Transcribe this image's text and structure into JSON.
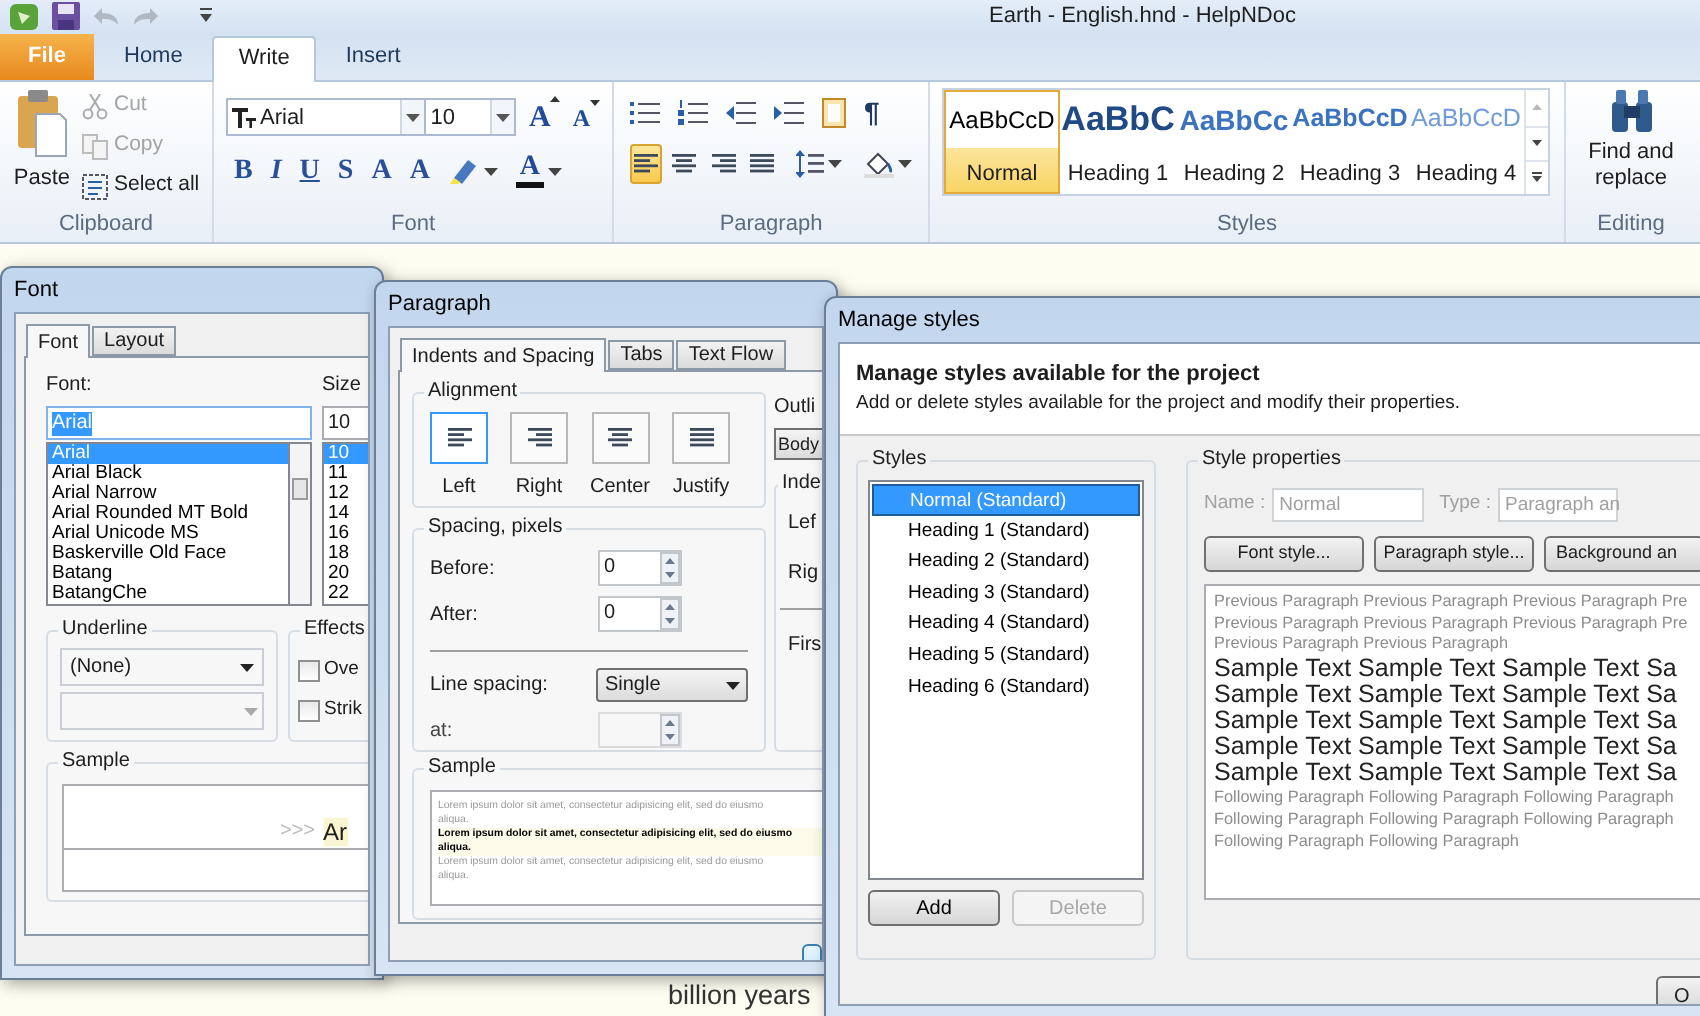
{
  "title_bar": {
    "title": "Earth - English.hnd - HelpNDoc"
  },
  "ribbon_tabs": [
    {
      "label": "File",
      "kind": "application",
      "selected": false
    },
    {
      "label": "Home",
      "kind": "tab",
      "selected": false
    },
    {
      "label": "Write",
      "kind": "tab",
      "selected": true
    },
    {
      "label": "Insert",
      "kind": "tab",
      "selected": false
    }
  ],
  "clipboard": {
    "caption": "Clipboard",
    "paste": "Paste",
    "actions": [
      {
        "label": "Cut",
        "kind": "cut",
        "disabled": true
      },
      {
        "label": "Copy",
        "kind": "copy",
        "disabled": true
      },
      {
        "label": "Select all",
        "kind": "select",
        "disabled": false
      }
    ]
  },
  "font": {
    "caption": "Font",
    "family": "Arial",
    "size": "10",
    "size_buttons": [
      {
        "label": "A",
        "kind": "grow"
      },
      {
        "label": "A",
        "kind": "shrink"
      }
    ],
    "format_buttons": [
      {
        "label": "B",
        "kind": "bold"
      },
      {
        "label": "I",
        "kind": "italic"
      },
      {
        "label": "U",
        "kind": "underline"
      },
      {
        "label": "S",
        "kind": "strike"
      },
      {
        "label": "A",
        "kind": "subscript"
      },
      {
        "label": "A",
        "kind": "superscript"
      }
    ],
    "color_button": "A"
  },
  "paragraph": {
    "caption": "Paragraph",
    "marks_button": "¶",
    "alignments": [
      {
        "kind": "left",
        "selected": true
      },
      {
        "kind": "center",
        "selected": false
      },
      {
        "kind": "right",
        "selected": false
      },
      {
        "kind": "justify",
        "selected": false
      }
    ]
  },
  "styles": {
    "caption": "Styles",
    "items": [
      {
        "sample": "AaBbCcD",
        "label": "Normal",
        "kind": "normal",
        "selected": true
      },
      {
        "sample": "AaBbC",
        "label": "Heading 1",
        "kind": "heading1",
        "selected": false
      },
      {
        "sample": "AaBbCc",
        "label": "Heading 2",
        "kind": "heading2",
        "selected": false
      },
      {
        "sample": "AaBbCcD",
        "label": "Heading 3",
        "kind": "heading3",
        "selected": false
      },
      {
        "sample": "AaBbCcD",
        "label": "Heading 4",
        "kind": "heading4",
        "selected": false
      }
    ]
  },
  "editing": {
    "caption": "Editing",
    "label": "Find and replace"
  },
  "document": {
    "text": "billion years"
  },
  "font_dialog": {
    "title": "Font",
    "tabs": [
      {
        "label": "Font",
        "selected": true
      },
      {
        "label": "Layout",
        "selected": false
      }
    ],
    "font_label": "Font:",
    "font_value": "Arial",
    "fonts": [
      {
        "label": "Arial",
        "selected": true
      },
      {
        "label": "Arial Black",
        "selected": false
      },
      {
        "label": "Arial Narrow",
        "selected": false
      },
      {
        "label": "Arial Rounded MT Bold",
        "selected": false
      },
      {
        "label": "Arial Unicode MS",
        "selected": false
      },
      {
        "label": "Baskerville Old Face",
        "selected": false
      },
      {
        "label": "Batang",
        "selected": false
      },
      {
        "label": "BatangChe",
        "selected": false
      }
    ],
    "size_label": "Size",
    "size_value": "10",
    "sizes": [
      {
        "label": "10",
        "selected": true
      },
      {
        "label": "11",
        "selected": false
      },
      {
        "label": "12",
        "selected": false
      },
      {
        "label": "14",
        "selected": false
      },
      {
        "label": "16",
        "selected": false
      },
      {
        "label": "18",
        "selected": false
      },
      {
        "label": "20",
        "selected": false
      },
      {
        "label": "22",
        "selected": false
      }
    ],
    "underline": {
      "label": "Underline",
      "value": "(None)"
    },
    "effects": {
      "label": "Effects",
      "options": [
        {
          "label": "Ove",
          "checked": false
        },
        {
          "label": "Strik",
          "checked": false
        }
      ]
    },
    "sample": {
      "label": "Sample",
      "marker": ">>>",
      "text": "Ar"
    }
  },
  "paragraph_dialog": {
    "title": "Paragraph",
    "tabs": [
      {
        "label": "Indents and Spacing",
        "selected": true
      },
      {
        "label": "Tabs",
        "selected": false
      },
      {
        "label": "Text Flow",
        "selected": false
      }
    ],
    "alignment": {
      "label": "Alignment",
      "options": [
        {
          "label": "Left",
          "kind": "left",
          "selected": true
        },
        {
          "label": "Right",
          "kind": "right",
          "selected": false
        },
        {
          "label": "Center",
          "kind": "center",
          "selected": false
        },
        {
          "label": "Justify",
          "kind": "justify",
          "selected": false
        }
      ]
    },
    "spacing": {
      "label": "Spacing, pixels",
      "fields": [
        {
          "label": "Before:",
          "value": "0",
          "disabled": false
        },
        {
          "label": "After:",
          "value": "0",
          "disabled": false
        }
      ],
      "line_spacing_label": "Line spacing:",
      "line_spacing": "Single",
      "at": {
        "label": "at:",
        "disabled": true
      }
    },
    "outline": {
      "label": "Outli",
      "value": "Body"
    },
    "indents": {
      "label": "Inde",
      "rows": [
        "Lef",
        "Rig"
      ],
      "first": "Firs"
    },
    "sample": {
      "label": "Sample",
      "paragraphs": [
        {
          "kind": "previous",
          "lines": [
            "Lorem ipsum dolor sit amet, consectetur adipisicing elit, sed do eiusmo",
            "aliqua."
          ]
        },
        {
          "kind": "current",
          "lines": [
            "Lorem ipsum dolor sit amet, consectetur adipisicing elit, sed do eiusmo",
            "aliqua."
          ]
        },
        {
          "kind": "following",
          "lines": [
            "Lorem ipsum dolor sit amet, consectetur adipisicing elit, sed do eiusmo",
            "aliqua."
          ]
        }
      ]
    }
  },
  "manage_styles": {
    "title": "Manage styles",
    "heading": "Manage styles available for the project",
    "description": "Add or delete styles available for the project and modify their properties.",
    "styles_label": "Styles",
    "styles": [
      {
        "label": "Normal (Standard)",
        "selected": true
      },
      {
        "label": "Heading 1 (Standard)",
        "selected": false
      },
      {
        "label": "Heading 2 (Standard)",
        "selected": false
      },
      {
        "label": "Heading 3 (Standard)",
        "selected": false
      },
      {
        "label": "Heading 4 (Standard)",
        "selected": false
      },
      {
        "label": "Heading 5 (Standard)",
        "selected": false
      },
      {
        "label": "Heading 6 (Standard)",
        "selected": false
      }
    ],
    "buttons": [
      {
        "label": "Add",
        "disabled": false
      },
      {
        "label": "Delete",
        "disabled": true
      }
    ],
    "properties": {
      "label": "Style properties",
      "name": {
        "label": "Name :",
        "value": "Normal",
        "disabled": true
      },
      "type": {
        "label": "Type :",
        "value": "Paragraph an",
        "disabled": true
      },
      "buttons": [
        "Font style...",
        "Paragraph style...",
        "Background an"
      ],
      "preview": [
        {
          "kind": "previous",
          "lines": [
            "Previous Paragraph Previous Paragraph Previous Paragraph Pre",
            "Previous Paragraph Previous Paragraph Previous Paragraph Pre",
            "Previous Paragraph Previous Paragraph"
          ]
        },
        {
          "kind": "sample",
          "lines": [
            "Sample Text Sample Text Sample Text Sa",
            "Sample Text Sample Text Sample Text Sa",
            "Sample Text Sample Text Sample Text Sa",
            "Sample Text Sample Text Sample Text Sa",
            "Sample Text Sample Text Sample Text Sa"
          ]
        },
        {
          "kind": "following",
          "lines": [
            "Following Paragraph Following Paragraph Following Paragraph",
            "Following Paragraph Following Paragraph Following Paragraph",
            "Following Paragraph Following Paragraph"
          ]
        }
      ]
    },
    "ok": "O"
  }
}
